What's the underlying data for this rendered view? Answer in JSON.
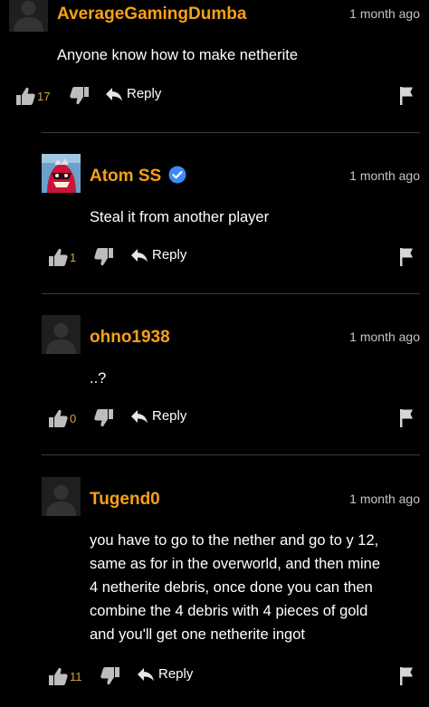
{
  "comments": [
    {
      "username": "AverageGamingDumba",
      "time": "1 month ago",
      "text": "Anyone know how to make netherite",
      "likes": "17",
      "reply_label": "Reply"
    },
    {
      "username": "Atom SS",
      "verified": true,
      "time": "1 month ago",
      "text": "Steal it from another player",
      "likes": "1",
      "reply_label": "Reply"
    },
    {
      "username": "ohno1938",
      "time": "1 month ago",
      "text": "..?",
      "likes": "0",
      "reply_label": "Reply"
    },
    {
      "username": "Tugend0",
      "time": "1 month ago",
      "text_lines": [
        "you have to go to the nether and go to y 12,",
        "same as for in the overworld, and then mine",
        "4 netherite debris, once done you can then",
        "combine the 4 debris with 4 pieces of gold",
        "and you'll get one netherite ingot"
      ],
      "likes": "11",
      "reply_label": "Reply"
    }
  ],
  "colors": {
    "background": "#000000",
    "username": "#f6a01a",
    "like_count": "#cfa43a",
    "verified_badge": "#3d8af7",
    "divider": "#3b3b3b"
  },
  "icons": [
    "default-avatar-icon",
    "thumbs-up-icon",
    "thumbs-down-icon",
    "reply-arrow-icon",
    "flag-icon",
    "verified-badge-icon"
  ]
}
